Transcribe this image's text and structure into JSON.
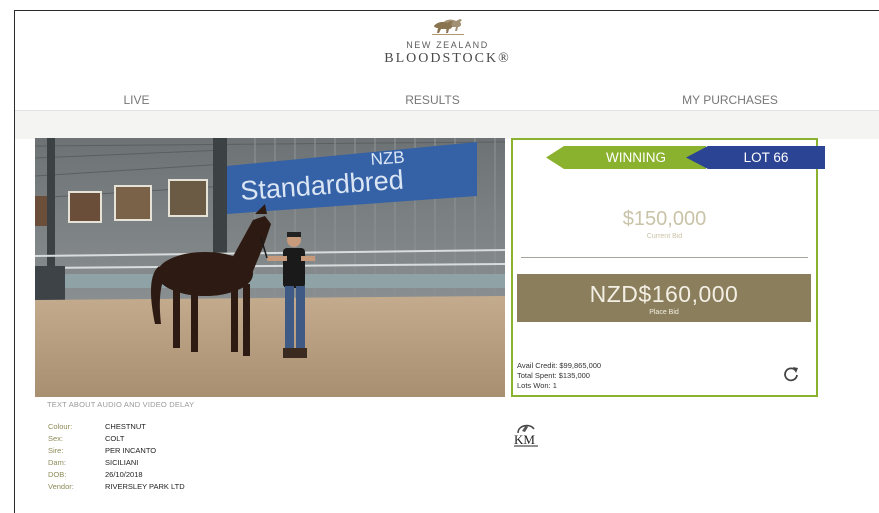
{
  "header": {
    "brand_line1": "NEW ZEALAND",
    "brand_line2": "BLOODSTOCK®"
  },
  "nav": {
    "tabs": [
      {
        "label": "LIVE",
        "active": true
      },
      {
        "label": "RESULTS",
        "active": false
      },
      {
        "label": "MY PURCHASES",
        "active": false
      }
    ]
  },
  "video": {
    "sign_text": "Standardbred",
    "sign_brand": "NZB",
    "audio_note": "TEXT ABOUT AUDIO AND VIDEO DELAY"
  },
  "lot_details": [
    {
      "label": "Colour:",
      "value": "CHESTNUT"
    },
    {
      "label": "Sex:",
      "value": "COLT"
    },
    {
      "label": "Sire:",
      "value": "PER INCANTO"
    },
    {
      "label": "Dam:",
      "value": "SICILIANI"
    },
    {
      "label": "DOB:",
      "value": "26/10/2018"
    },
    {
      "label": "Vendor:",
      "value": "RIVERSLEY PARK LTD"
    }
  ],
  "vendor_logo": "KM",
  "bid_panel": {
    "status": "WINNING",
    "lot": "LOT 66",
    "current_bid": "$150,000",
    "current_bid_label": "Current Bid",
    "place_bid_amount": "NZD$160,000",
    "place_bid_label": "Place Bid",
    "avail_credit": "Avail Credit: $99,865,000",
    "total_spent": "Total Spent: $135,000",
    "lots_won": "Lots Won: 1"
  },
  "colors": {
    "winning_green": "#8bb22e",
    "lot_blue": "#2c4494",
    "place_bid_bg": "#8a7e5c",
    "panel_border": "#8bb22e"
  },
  "icons": [
    "horses-logo-icon",
    "refresh-icon",
    "km-logo"
  ]
}
